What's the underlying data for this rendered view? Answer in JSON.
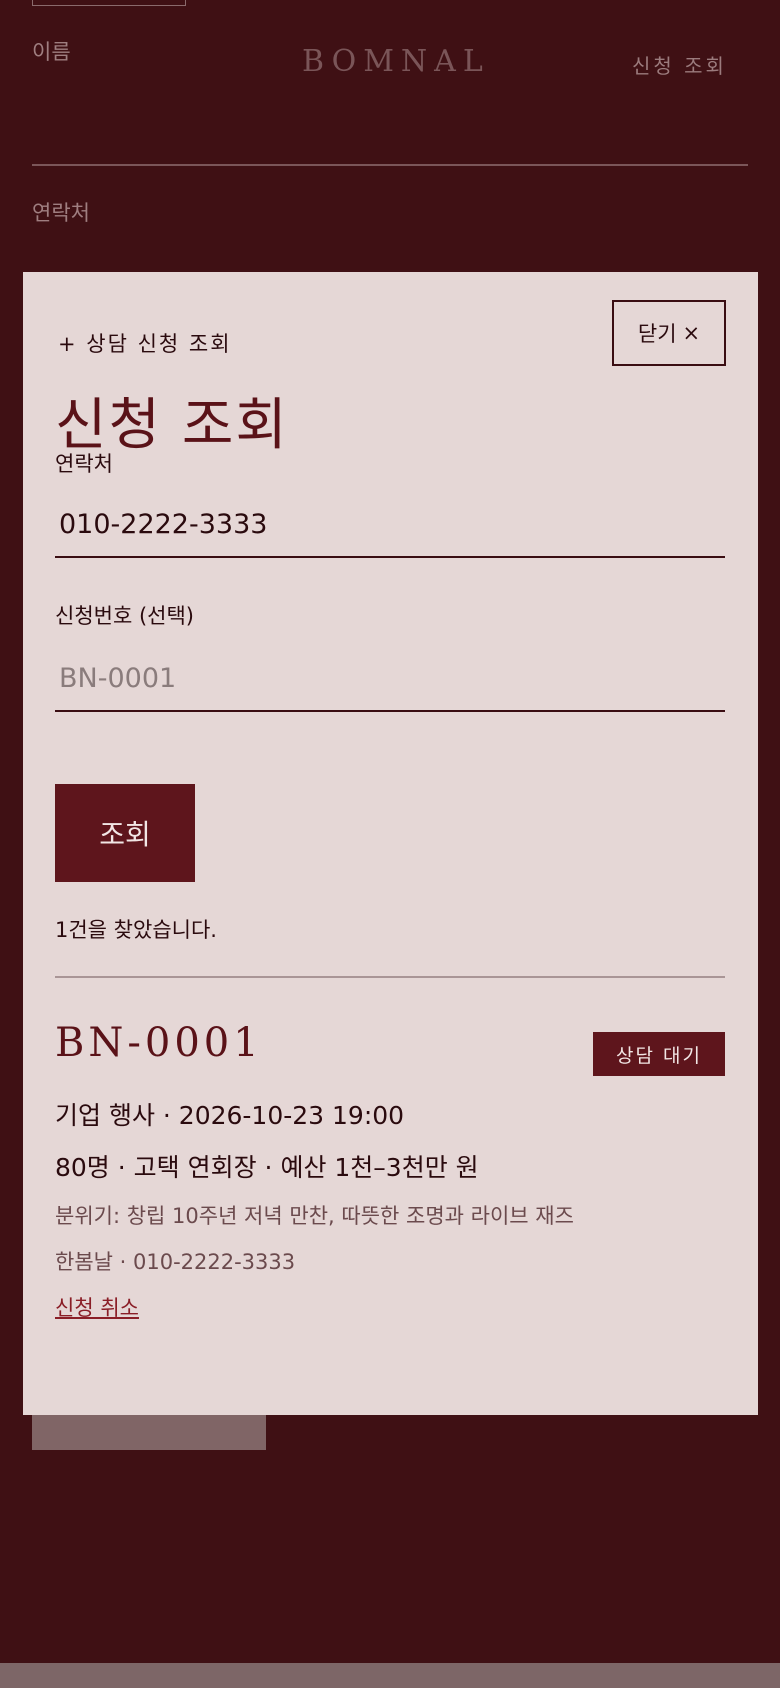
{
  "background": {
    "name_label": "이름",
    "logo": "BOMNAL",
    "nav_lookup": "신청 조회",
    "phone_label": "연락처"
  },
  "modal": {
    "eyebrow": "+ 상담 신청 조회",
    "close_label": "닫기",
    "close_icon": "×",
    "title": "신청 조회",
    "phone_label": "연락처",
    "phone_value": "010-2222-3333",
    "app_number_label": "신청번호 (선택)",
    "app_number_placeholder": "BN-0001",
    "submit_label": "조회",
    "result_message": "1건을 찾았습니다."
  },
  "record": {
    "id": "BN-0001",
    "status": "상담 대기",
    "line1": "기업 행사 · 2026-10-23 19:00",
    "line2": "80명 · 고택 연회장 · 예산 1천–3천만 원",
    "line3": "분위기: 창립 10주년 저녁 만찬, 따뜻한 조명과 라이브 재즈",
    "line4": "한봄날 · 010-2222-3333",
    "cancel_label": "신청 취소"
  },
  "colors": {
    "page_bg": "#3f1014",
    "modal_bg": "#e5d7d6",
    "accent": "#5e151c",
    "text_dark": "#2a0a0e",
    "link": "#8a1e27"
  }
}
